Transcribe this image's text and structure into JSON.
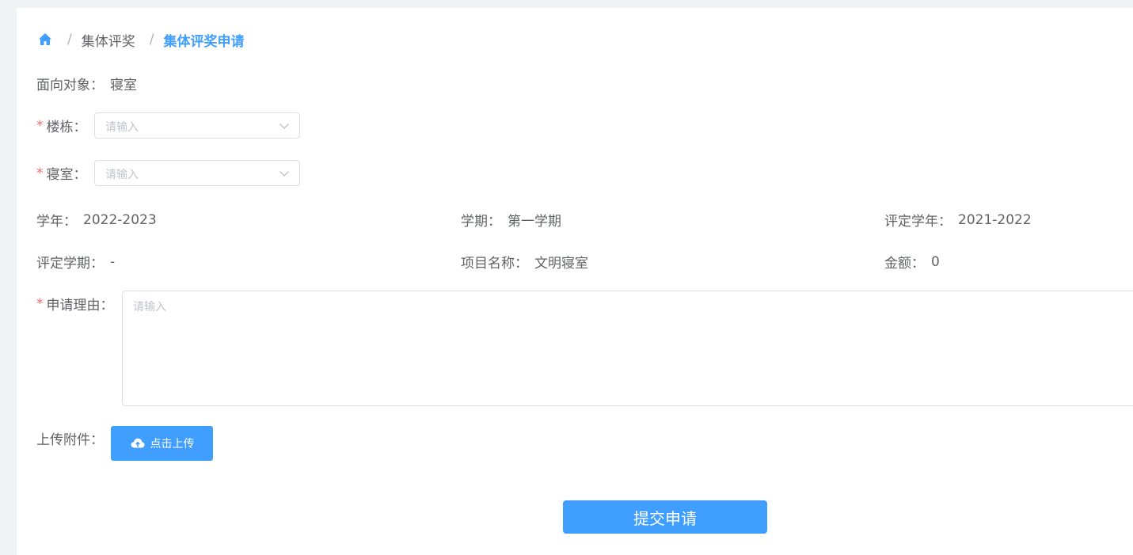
{
  "breadcrumb": {
    "items": [
      "集体评奖",
      "集体评奖申请"
    ]
  },
  "form": {
    "target": {
      "label": "面向对象：",
      "value": "寝室"
    },
    "building": {
      "label": "楼栋：",
      "placeholder": "请输入"
    },
    "room": {
      "label": "寝室：",
      "placeholder": "请输入"
    },
    "info": {
      "academic_year": {
        "label": "学年：",
        "value": "2022-2023"
      },
      "semester": {
        "label": "学期：",
        "value": "第一学期"
      },
      "eval_year": {
        "label": "评定学年：",
        "value": "2021-2022"
      },
      "eval_semester": {
        "label": "评定学期：",
        "value": "-"
      },
      "project_name": {
        "label": "项目名称：",
        "value": "文明寝室"
      },
      "amount": {
        "label": "金额：",
        "value": "0"
      }
    },
    "reason": {
      "label": "申请理由：",
      "placeholder": "请输入"
    },
    "attachment": {
      "label": "上传附件：",
      "button_label": "点击上传"
    },
    "required_mark": "*"
  },
  "submit_label": "提交申请",
  "colors": {
    "accent": "#409eff",
    "required": "#f56c6c"
  },
  "icons": {
    "home": "home-icon",
    "chevron": "chevron-down-icon",
    "upload": "cloud-upload-icon"
  }
}
